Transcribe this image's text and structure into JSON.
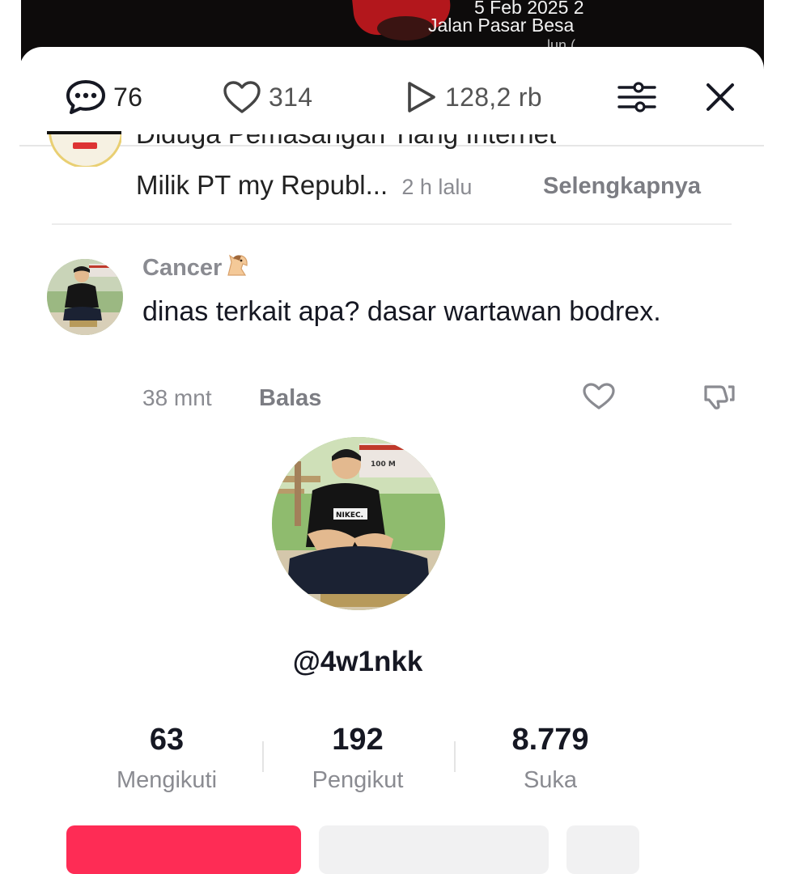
{
  "video": {
    "date": "5 Feb 2025 2",
    "location": "Jalan Pasar Besa",
    "location_partial": "lun ("
  },
  "toolbar": {
    "comments_count": "76",
    "likes_count": "314",
    "views_count": "128,2 rb"
  },
  "caption": {
    "line1": "Diduga Pemasangan Tiang Internet",
    "line2": "Milik PT my Republ",
    "ellipsis": "...",
    "time": "2 h lalu",
    "more_label": "Selengkapnya"
  },
  "comment": {
    "username": "Cancer",
    "text": "dinas terkait apa? dasar wartawan bodrex.",
    "time": "38 mnt",
    "reply_label": "Balas"
  },
  "profile": {
    "handle": "@4w1nkk",
    "following_count": "63",
    "following_label": "Mengikuti",
    "followers_count": "192",
    "followers_label": "Pengikut",
    "likes_count": "8.779",
    "likes_label": "Suka",
    "shirt_text": "NIKEC.",
    "sign_text": "100 M"
  },
  "icons": {
    "comments": "speech-bubble-icon",
    "likes": "heart-icon",
    "views": "play-icon",
    "filter": "sliders-icon",
    "close": "close-icon",
    "comment_like": "heart-outline-icon",
    "comment_dislike": "thumbs-down-icon",
    "emoji": "horse-emoji-icon"
  },
  "colors": {
    "accent": "#fe2c55",
    "text_primary": "#161823",
    "text_secondary": "#8a8b91"
  }
}
